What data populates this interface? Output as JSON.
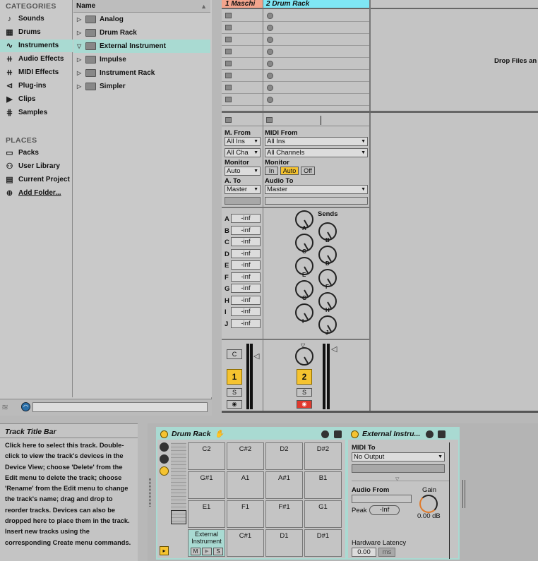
{
  "browser": {
    "categories_heading": "CATEGORIES",
    "categories": [
      {
        "label": "Sounds",
        "icon": "note-icon"
      },
      {
        "label": "Drums",
        "icon": "drum-grid-icon"
      },
      {
        "label": "Instruments",
        "icon": "waveform-icon",
        "selected": true
      },
      {
        "label": "Audio Effects",
        "icon": "audio-fx-icon"
      },
      {
        "label": "MIDI Effects",
        "icon": "midi-fx-icon"
      },
      {
        "label": "Plug-ins",
        "icon": "plugin-icon"
      },
      {
        "label": "Clips",
        "icon": "clip-icon"
      },
      {
        "label": "Samples",
        "icon": "sample-icon"
      }
    ],
    "places_heading": "PLACES",
    "places": [
      {
        "label": "Packs"
      },
      {
        "label": "User Library"
      },
      {
        "label": "Current Project"
      },
      {
        "label": "Add Folder..."
      }
    ],
    "name_header": "Name",
    "items": [
      {
        "label": "Analog",
        "expanded": false
      },
      {
        "label": "Drum Rack",
        "expanded": false
      },
      {
        "label": "External Instrument",
        "expanded": true,
        "selected": true
      },
      {
        "label": "Impulse",
        "expanded": false
      },
      {
        "label": "Instrument Rack",
        "expanded": false
      },
      {
        "label": "Simpler",
        "expanded": false
      }
    ]
  },
  "session": {
    "track1_title": "1 Maschi",
    "track2_title": "2 Drum Rack",
    "drop_hint": "Drop Files an",
    "track1": {
      "m_from_label": "M. From",
      "m_from_value": "All Ins",
      "channel_value": "All Cha",
      "monitor_label": "Monitor",
      "monitor_value": "Auto",
      "a_to_label": "A. To",
      "a_to_value": "Master",
      "sends": [
        {
          "label": "A",
          "value": "-inf"
        },
        {
          "label": "B",
          "value": "-inf"
        },
        {
          "label": "C",
          "value": "-inf"
        },
        {
          "label": "D",
          "value": "-inf"
        },
        {
          "label": "E",
          "value": "-inf"
        },
        {
          "label": "F",
          "value": "-inf"
        },
        {
          "label": "G",
          "value": "-inf"
        },
        {
          "label": "H",
          "value": "-inf"
        },
        {
          "label": "I",
          "value": "-inf"
        },
        {
          "label": "J",
          "value": "-inf"
        }
      ],
      "pan_label": "C",
      "number": "1",
      "solo": "S"
    },
    "track2": {
      "midi_from_label": "MIDI From",
      "midi_from_value": "All Ins",
      "channel_value": "All Channels",
      "monitor_label": "Monitor",
      "monitor_in": "In",
      "monitor_auto": "Auto",
      "monitor_off": "Off",
      "audio_to_label": "Audio To",
      "audio_to_value": "Master",
      "sends_label": "Sends",
      "send_knobs": [
        "A",
        "B",
        "C",
        "D",
        "E",
        "F",
        "G",
        "H",
        "I",
        "J"
      ],
      "number": "2",
      "solo": "S",
      "arm_color": "#e03a2e"
    },
    "accent_color": "#f5c330",
    "selection_color": "#a9dad2"
  },
  "info": {
    "title": "Track Title Bar",
    "text": "Click here to select this track. Double-click to view the track's devices in the Device View; choose 'Delete' from the Edit menu to delete the track; choose 'Rename' from the Edit menu to change the track's name; drag and drop to reorder tracks. Devices can also be dropped here to place them in the track. Insert new tracks using the corresponding Create menu commands."
  },
  "drum_rack": {
    "title": "Drum Rack",
    "pads": [
      "C2",
      "C#2",
      "D2",
      "D#2",
      "G#1",
      "A1",
      "A#1",
      "B1",
      "E1",
      "F1",
      "F#1",
      "G1",
      "C#1",
      "D1",
      "D#1"
    ],
    "ext_pad_label": "External Instrument",
    "pad_m": "M",
    "pad_s": "S"
  },
  "ext_instrument": {
    "title": "External Instru...",
    "midi_to_label": "MIDI To",
    "midi_to_value": "No Output",
    "audio_from_label": "Audio From",
    "gain_label": "Gain",
    "gain_value": "0.00 dB",
    "peak_label": "Peak",
    "peak_value": "-Inf",
    "latency_label": "Hardware Latency",
    "latency_value": "0.00",
    "latency_unit": "ms"
  }
}
